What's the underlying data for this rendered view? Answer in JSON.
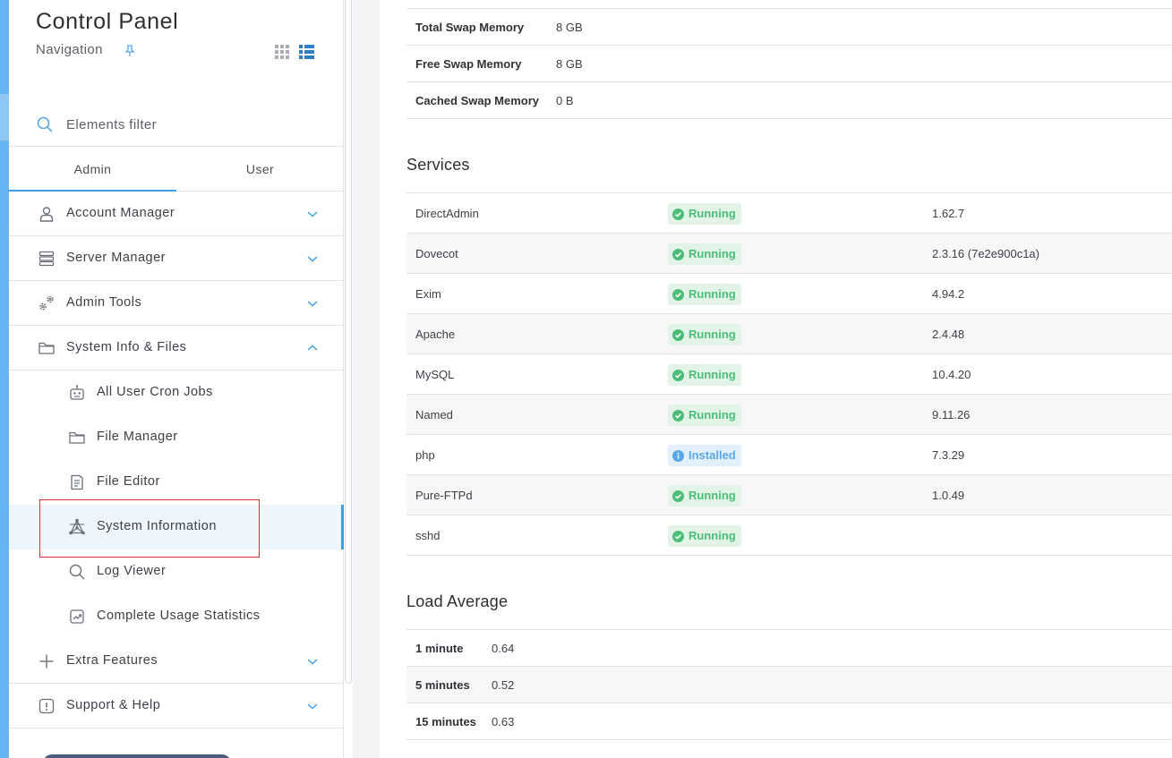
{
  "sidebar": {
    "title": "Control Panel",
    "subtitle": "Navigation",
    "filter_placeholder": "Elements filter",
    "tabs": [
      {
        "label": "Admin",
        "active": true
      },
      {
        "label": "User",
        "active": false
      }
    ],
    "items": [
      {
        "label": "Account Manager",
        "icon": "user-icon",
        "expanded": false
      },
      {
        "label": "Server Manager",
        "icon": "server-icon",
        "expanded": false
      },
      {
        "label": "Admin Tools",
        "icon": "gears-icon",
        "expanded": false
      },
      {
        "label": "System Info & Files",
        "icon": "folder-icon",
        "expanded": true
      },
      {
        "label": "Extra Features",
        "icon": "plus-icon",
        "expanded": false
      },
      {
        "label": "Support & Help",
        "icon": "alert-icon",
        "expanded": false
      }
    ],
    "subitems": [
      {
        "label": "All User Cron Jobs",
        "icon": "robot-icon"
      },
      {
        "label": "File Manager",
        "icon": "folder-icon"
      },
      {
        "label": "File Editor",
        "icon": "document-icon"
      },
      {
        "label": "System Information",
        "icon": "network-icon",
        "active": true
      },
      {
        "label": "Log Viewer",
        "icon": "search-icon"
      },
      {
        "label": "Complete Usage Statistics",
        "icon": "chart-icon"
      }
    ]
  },
  "memory": [
    {
      "label": "Total Swap Memory",
      "value": "8 GB"
    },
    {
      "label": "Free Swap Memory",
      "value": "8 GB"
    },
    {
      "label": "Cached Swap Memory",
      "value": "0 B"
    }
  ],
  "services": {
    "title": "Services",
    "rows": [
      {
        "name": "DirectAdmin",
        "status": "Running",
        "version": "1.62.7"
      },
      {
        "name": "Dovecot",
        "status": "Running",
        "version": "2.3.16 (7e2e900c1a)"
      },
      {
        "name": "Exim",
        "status": "Running",
        "version": "4.94.2"
      },
      {
        "name": "Apache",
        "status": "Running",
        "version": "2.4.48"
      },
      {
        "name": "MySQL",
        "status": "Running",
        "version": "10.4.20"
      },
      {
        "name": "Named",
        "status": "Running",
        "version": "9.11.26"
      },
      {
        "name": "php",
        "status": "Installed",
        "version": "7.3.29"
      },
      {
        "name": "Pure-FTPd",
        "status": "Running",
        "version": "1.0.49"
      },
      {
        "name": "sshd",
        "status": "Running",
        "version": ""
      }
    ]
  },
  "load_average": {
    "title": "Load Average",
    "rows": [
      {
        "label": "1 minute",
        "value": "0.64"
      },
      {
        "label": "5 minutes",
        "value": "0.52"
      },
      {
        "label": "15 minutes",
        "value": "0.63"
      }
    ]
  },
  "colors": {
    "accent": "#3d9ee6",
    "running": "#4bbd77",
    "installed": "#5aa9e6",
    "highlight_box": "#d9302c"
  }
}
